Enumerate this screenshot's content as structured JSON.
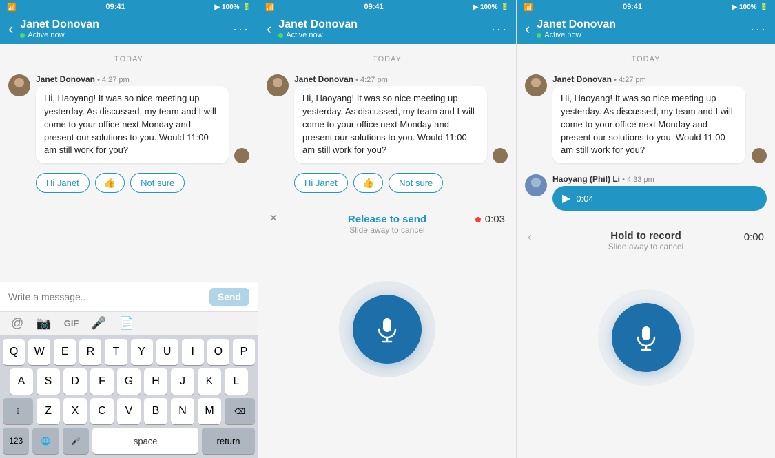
{
  "panels": [
    {
      "id": "panel1",
      "statusBar": {
        "time": "09:41",
        "battery": "100%",
        "signal": "●●●●"
      },
      "header": {
        "backLabel": "‹",
        "name": "Janet Donovan",
        "status": "Active now",
        "moreBtn": "···"
      },
      "dateDivider": "TODAY",
      "message1": {
        "sender": "Janet Donovan",
        "time": "4:27 pm",
        "text": "Hi, Haoyang! It was so nice meeting up yesterday. As discussed, my team and I will come to your office next Monday and present our solutions to you. Would 11:00 am still work for you?"
      },
      "quickReplies": [
        {
          "label": "Hi Janet",
          "type": "text"
        },
        {
          "label": "👍",
          "type": "emoji"
        },
        {
          "label": "Not sure",
          "type": "text"
        }
      ],
      "inputPlaceholder": "Write a message...",
      "sendLabel": "Send",
      "toolbarIcons": [
        "@",
        "📷",
        "GIF",
        "🎤",
        "📄"
      ]
    },
    {
      "id": "panel2",
      "statusBar": {
        "time": "09:41",
        "battery": "100%"
      },
      "header": {
        "backLabel": "‹",
        "name": "Janet Donovan",
        "status": "Active now",
        "moreBtn": "···"
      },
      "dateDivider": "TODAY",
      "message1": {
        "sender": "Janet Donovan",
        "time": "4:27 pm",
        "text": "Hi, Haoyang! It was so nice meeting up yesterday. As discussed, my team and I will come to your office next Monday and present our solutions to you. Would 11:00 am still work for you?"
      },
      "quickReplies": [
        {
          "label": "Hi Janet",
          "type": "text"
        },
        {
          "label": "👍",
          "type": "emoji"
        },
        {
          "label": "Not sure",
          "type": "text"
        }
      ],
      "recording": {
        "cancelIcon": "×",
        "title": "Release to send",
        "subtitle": "Slide away to cancel",
        "timer": "0:03"
      }
    },
    {
      "id": "panel3",
      "statusBar": {
        "time": "09:41",
        "battery": "100%"
      },
      "header": {
        "backLabel": "‹",
        "name": "Janet Donovan",
        "status": "Active now",
        "moreBtn": "···"
      },
      "dateDivider": "TODAY",
      "message1": {
        "sender": "Janet Donovan",
        "time": "4:27 pm",
        "text": "Hi, Haoyang! It was so nice meeting up yesterday. As discussed, my team and I will come to your office next Monday and present our solutions to you. Would 11:00 am still work for you?"
      },
      "message2": {
        "sender": "Haoyang (Phil) Li",
        "time": "4:33 pm",
        "voiceDuration": "0:04"
      },
      "holdRecord": {
        "cancelIcon": "‹",
        "title": "Hold to record",
        "subtitle": "Slide away to cancel",
        "timer": "0:00"
      }
    }
  ]
}
